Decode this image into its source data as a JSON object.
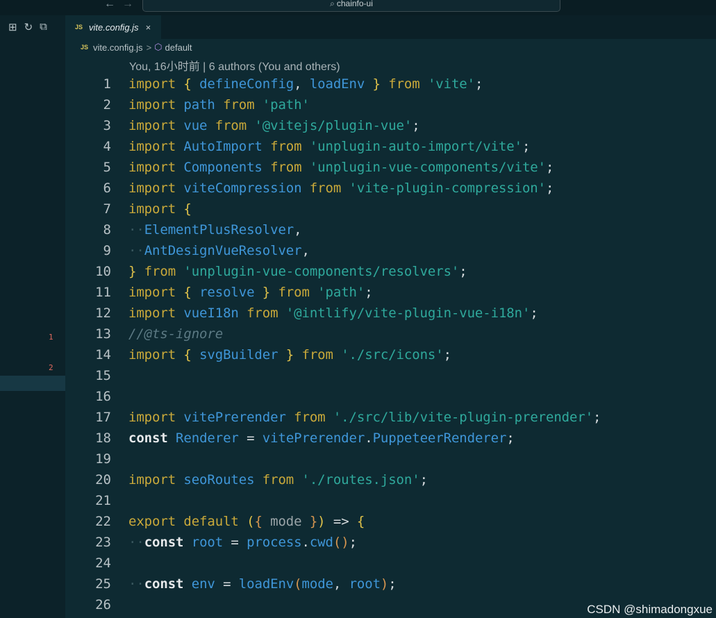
{
  "window": {
    "search_text": "chainfo-ui",
    "back_icon": "arrow-left-icon",
    "forward_icon": "arrow-right-icon"
  },
  "sidebar": {
    "markers": [
      "1",
      "2"
    ]
  },
  "tab": {
    "badge": "JS",
    "title": "vite.config.js",
    "close": "×"
  },
  "breadcrumb": {
    "badge": "JS",
    "file": "vite.config.js",
    "separator": ">",
    "symbol": "default"
  },
  "codelens": "You, 16小时前 | 6 authors (You and others)",
  "code_lines": [
    {
      "n": "1",
      "t": [
        [
          "kw",
          "import "
        ],
        [
          "br",
          "{ "
        ],
        [
          "id",
          "defineConfig"
        ],
        [
          "pn",
          ", "
        ],
        [
          "id",
          "loadEnv"
        ],
        [
          "br",
          " }"
        ],
        [
          "kw",
          " from "
        ],
        [
          "st",
          "'vite'"
        ],
        [
          "pn",
          ";"
        ]
      ]
    },
    {
      "n": "2",
      "t": [
        [
          "kw",
          "import "
        ],
        [
          "id",
          "path"
        ],
        [
          "kw",
          " from "
        ],
        [
          "st",
          "'path'"
        ]
      ]
    },
    {
      "n": "3",
      "t": [
        [
          "kw",
          "import "
        ],
        [
          "id",
          "vue"
        ],
        [
          "kw",
          " from "
        ],
        [
          "st",
          "'@vitejs/plugin-vue'"
        ],
        [
          "pn",
          ";"
        ]
      ]
    },
    {
      "n": "4",
      "t": [
        [
          "kw",
          "import "
        ],
        [
          "id",
          "AutoImport"
        ],
        [
          "kw",
          " from "
        ],
        [
          "st",
          "'unplugin-auto-import/vite'"
        ],
        [
          "pn",
          ";"
        ]
      ]
    },
    {
      "n": "5",
      "t": [
        [
          "kw",
          "import "
        ],
        [
          "id",
          "Components"
        ],
        [
          "kw",
          " from "
        ],
        [
          "st",
          "'unplugin-vue-components/vite'"
        ],
        [
          "pn",
          ";"
        ]
      ]
    },
    {
      "n": "6",
      "t": [
        [
          "kw",
          "import "
        ],
        [
          "id",
          "viteCompression"
        ],
        [
          "kw",
          " from "
        ],
        [
          "st",
          "'vite-plugin-compression'"
        ],
        [
          "pn",
          ";"
        ]
      ]
    },
    {
      "n": "7",
      "t": [
        [
          "kw",
          "import "
        ],
        [
          "br",
          "{"
        ]
      ]
    },
    {
      "n": "8",
      "t": [
        [
          "ws",
          "··"
        ],
        [
          "id",
          "ElementPlusResolver"
        ],
        [
          "pn",
          ","
        ]
      ]
    },
    {
      "n": "9",
      "t": [
        [
          "ws",
          "··"
        ],
        [
          "id",
          "AntDesignVueResolver"
        ],
        [
          "pn",
          ","
        ]
      ]
    },
    {
      "n": "10",
      "t": [
        [
          "br",
          "}"
        ],
        [
          "kw",
          " from "
        ],
        [
          "st",
          "'unplugin-vue-components/resolvers'"
        ],
        [
          "pn",
          ";"
        ]
      ]
    },
    {
      "n": "11",
      "t": [
        [
          "kw",
          "import "
        ],
        [
          "br",
          "{ "
        ],
        [
          "id",
          "resolve"
        ],
        [
          "br",
          " }"
        ],
        [
          "kw",
          " from "
        ],
        [
          "st",
          "'path'"
        ],
        [
          "pn",
          ";"
        ]
      ]
    },
    {
      "n": "12",
      "t": [
        [
          "kw",
          "import "
        ],
        [
          "id",
          "vueI18n"
        ],
        [
          "kw",
          " from "
        ],
        [
          "st",
          "'@intlify/vite-plugin-vue-i18n'"
        ],
        [
          "pn",
          ";"
        ]
      ]
    },
    {
      "n": "13",
      "t": [
        [
          "cm",
          "//@ts-ignore"
        ]
      ]
    },
    {
      "n": "14",
      "t": [
        [
          "kw",
          "import "
        ],
        [
          "br",
          "{ "
        ],
        [
          "id",
          "svgBuilder"
        ],
        [
          "br",
          " }"
        ],
        [
          "kw",
          " from "
        ],
        [
          "st",
          "'./src/icons'"
        ],
        [
          "pn",
          ";"
        ]
      ]
    },
    {
      "n": "15",
      "t": []
    },
    {
      "n": "16",
      "t": []
    },
    {
      "n": "17",
      "t": [
        [
          "kw",
          "import "
        ],
        [
          "id",
          "vitePrerender"
        ],
        [
          "kw",
          " from "
        ],
        [
          "st",
          "'./src/lib/vite-plugin-prerender'"
        ],
        [
          "pn",
          ";"
        ]
      ]
    },
    {
      "n": "18",
      "t": [
        [
          "kwb",
          "const "
        ],
        [
          "id",
          "Renderer"
        ],
        [
          "pn",
          " = "
        ],
        [
          "id",
          "vitePrerender"
        ],
        [
          "pn",
          "."
        ],
        [
          "id",
          "PuppeteerRenderer"
        ],
        [
          "pn",
          ";"
        ]
      ]
    },
    {
      "n": "19",
      "t": []
    },
    {
      "n": "20",
      "t": [
        [
          "kw",
          "import "
        ],
        [
          "id",
          "seoRoutes"
        ],
        [
          "kw",
          " from "
        ],
        [
          "st",
          "'./routes.json'"
        ],
        [
          "pn",
          ";"
        ]
      ]
    },
    {
      "n": "21",
      "t": []
    },
    {
      "n": "22",
      "t": [
        [
          "kw",
          "export default "
        ],
        [
          "br",
          "("
        ],
        [
          "bp",
          "{ "
        ],
        [
          "dim",
          "mode"
        ],
        [
          "bp",
          " }"
        ],
        [
          "br",
          ")"
        ],
        [
          "pn",
          " => "
        ],
        [
          "br",
          "{"
        ]
      ]
    },
    {
      "n": "23",
      "t": [
        [
          "ws",
          "··"
        ],
        [
          "kwb",
          "const "
        ],
        [
          "id",
          "root"
        ],
        [
          "pn",
          " = "
        ],
        [
          "id",
          "process"
        ],
        [
          "pn",
          "."
        ],
        [
          "id",
          "cwd"
        ],
        [
          "bp",
          "()"
        ],
        [
          "pn",
          ";"
        ]
      ]
    },
    {
      "n": "24",
      "t": []
    },
    {
      "n": "25",
      "t": [
        [
          "ws",
          "··"
        ],
        [
          "kwb",
          "const "
        ],
        [
          "id",
          "env"
        ],
        [
          "pn",
          " = "
        ],
        [
          "id",
          "loadEnv"
        ],
        [
          "bp",
          "("
        ],
        [
          "id",
          "mode"
        ],
        [
          "pn",
          ", "
        ],
        [
          "id",
          "root"
        ],
        [
          "bp",
          ")"
        ],
        [
          "pn",
          ";"
        ]
      ]
    },
    {
      "n": "26",
      "t": []
    }
  ],
  "watermark": "CSDN @shimadongxue"
}
